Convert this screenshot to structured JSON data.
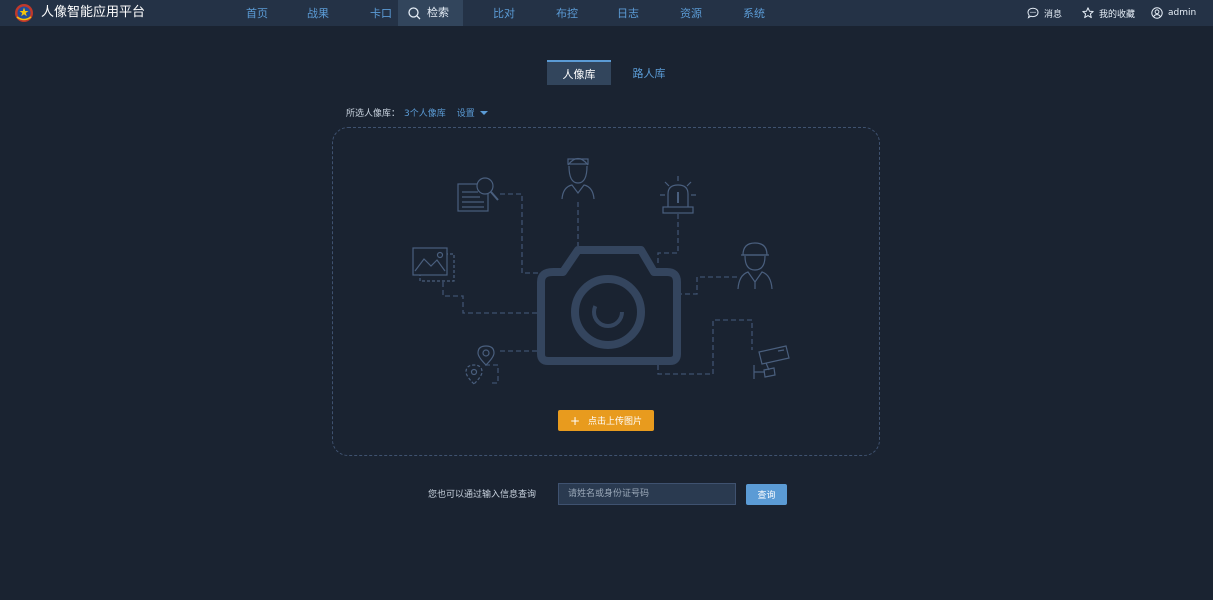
{
  "app": {
    "title": "人像智能应用平台"
  },
  "nav": {
    "items": [
      {
        "label": "首页"
      },
      {
        "label": "战果"
      },
      {
        "label": "卡口"
      },
      {
        "label": "检索",
        "active": true
      },
      {
        "label": "比对"
      },
      {
        "label": "布控"
      },
      {
        "label": "日志"
      },
      {
        "label": "资源"
      },
      {
        "label": "系统"
      }
    ]
  },
  "tools": {
    "messages_label": "消息",
    "favorites_label": "我的收藏",
    "user_label": "admin"
  },
  "tabs": [
    {
      "label": "人像库",
      "active": true
    },
    {
      "label": "路人库",
      "active": false
    }
  ],
  "library": {
    "label": "所选人像库：",
    "value": "3个人像库",
    "settings_label": "设置"
  },
  "upload": {
    "button_label": "点击上传图片",
    "icons": [
      "document-search-icon",
      "person-icon",
      "alarm-light-icon",
      "picture-icon",
      "camera-icon",
      "police-icon",
      "location-pin-icon",
      "surveillance-camera-icon"
    ]
  },
  "query": {
    "hint": "您也可以通过输入信息查询",
    "placeholder": "请姓名或身份证号码",
    "button_label": "查询"
  },
  "colors": {
    "background": "#1a2331",
    "topbar": "#243246",
    "accent": "#5b9bd5",
    "upload_button": "#e89b1e",
    "illustration": "#3f5270"
  }
}
